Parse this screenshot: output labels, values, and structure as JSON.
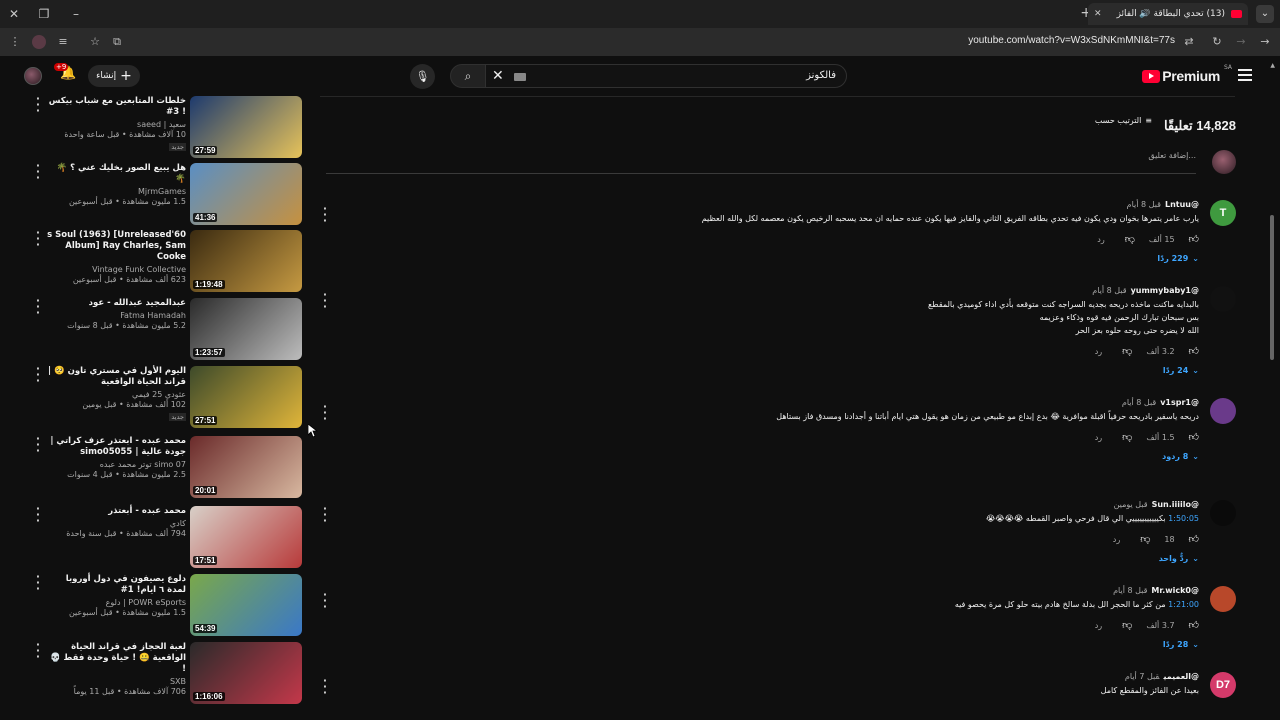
{
  "browser": {
    "tab_title": "(13) تحدي البطاقة 🔊 الفائز",
    "url": "youtube.com/watch?v=W3xSdNKmMNI&t=77s"
  },
  "header": {
    "logo_text": "Premium",
    "logo_sup": "SA",
    "search_query": "فالكونز",
    "create_label": "إنشاء",
    "notif_badge": "+9"
  },
  "recommendations": [
    {
      "title": "خلطات المتابعين مع شباب بيكس ! 3#",
      "channel": "سعيد | saeed",
      "stats": "10 آلاف مشاهدة • قبل ساعة واحدة",
      "badge": "جديد",
      "duration": "27:59",
      "colors": [
        "#1d3a6e",
        "#e7c35a"
      ]
    },
    {
      "title": "هل يبيع الصور بخليك عني ؟ 🌴🌴",
      "channel": "MjrmGames",
      "stats": "1.5 مليون مشاهدة • قبل أسبوعين",
      "badge": "",
      "duration": "41:36",
      "colors": [
        "#5a8fc4",
        "#c6913f"
      ]
    },
    {
      "title": "60's Soul (1963) [Unreleased Album] Ray Charles, Sam Cooke",
      "channel": "Vintage Funk Collective",
      "stats": "623 ألف مشاهدة • قبل أسبوعين",
      "badge": "",
      "duration": "1:19:48",
      "colors": [
        "#3a2a10",
        "#c69a42"
      ]
    },
    {
      "title": "عبدالمجيد عبدالله - عود",
      "channel": "Fatma Hamadah",
      "stats": "5.2 مليون مشاهدة • قبل 8 سنوات",
      "badge": "",
      "duration": "1:23:57",
      "colors": [
        "#2a2a2a",
        "#bdbdbd"
      ]
    },
    {
      "title": "اليوم الأول في مستري تاون 🥺 | قراند الحياة الواقعية",
      "channel": "عثودي 25 فيمي",
      "stats": "102 ألف مشاهدة • قبل يومين",
      "badge": "جديد",
      "duration": "27:51",
      "colors": [
        "#3d4a2a",
        "#e0b53a"
      ]
    },
    {
      "title": "محمد عبده - ابعتذر عزف كراتي | جودة عالية | simo05055",
      "channel": "simo 07 توتر محمد عبده",
      "stats": "2.5 مليون مشاهدة • قبل 4 سنوات",
      "badge": "",
      "duration": "20:01",
      "colors": [
        "#6a2a2a",
        "#d8b8a0"
      ]
    },
    {
      "title": "محمد عبده - أبعتذر",
      "channel": "كادي",
      "stats": "794 ألف مشاهدة • قبل سنة واحدة",
      "badge": "",
      "duration": "17:51",
      "colors": [
        "#d8d0c8",
        "#b83a3a"
      ]
    },
    {
      "title": "دلوع يصيفون في دول أوروبا لمدة ٦ ايام! 1#",
      "channel": "POWR eSports | دلوع",
      "stats": "1.5 مليون مشاهدة • قبل أسبوعين",
      "badge": "",
      "duration": "54:39",
      "colors": [
        "#7aa84a",
        "#3a78c8"
      ]
    },
    {
      "title": "لعبة الحجاز في قراند الحياة الواقعية 🤐 ! حياة وحدة فقط 💀 !",
      "channel": "SXB",
      "stats": "706 آلاف مشاهدة • قبل 11 يوماً",
      "badge": "",
      "duration": "1:16:06",
      "colors": [
        "#2a2a2a",
        "#c4384a"
      ]
    }
  ],
  "comments_header": {
    "count": "14,828 تعليقًا",
    "sort_label": "الترتيب حسب",
    "add_placeholder": "إضافة تعليق..."
  },
  "comments": [
    {
      "author": "@Lntuu",
      "time": "قبل 8 أيام",
      "avatar_letter": "T",
      "avatar_color": "#3f9a3f",
      "timestamp": "",
      "text": "يارب عامر يتمرها بخوان ودي يكون فيه تحدي بطاقه الفريق الثاني والفايز فيها يكون عنده حمايه ان محد يسحبه الرخيص يكون معصمه لكل والله العظيم",
      "likes": "15 ألف",
      "reply_label": "رد",
      "replies": "229 ردًا"
    },
    {
      "author": "@yummybaby1",
      "time": "قبل 8 أيام",
      "avatar_letter": "",
      "avatar_color": "#111111",
      "timestamp": "",
      "text": "بالبدايه ماكنت ماخذه دريحه بجديه السراجه كنت متوقعه بأدي اداء كوميدي بالمقطع\nبس سبحان تبارك الرحمن فيه قوه وذكاء وعزيمه\nالله لا يضره حتى روحه حلوه بعز الحر",
      "likes": "3.2 ألف",
      "reply_label": "رد",
      "replies": "24 ردًا"
    },
    {
      "author": "@v1spr1",
      "time": "قبل 8 أيام",
      "avatar_letter": "",
      "avatar_color": "#6a3a8a",
      "timestamp": "",
      "text": "دريحه ياسفير بادريحه حرفياً اقبلة موافرية 😂 بدع إبداع مو طبيعي من زمان هو يقول هتي ايام أباتنا و أجدادنا ومسدق فاز بستاهل",
      "likes": "1.5 ألف",
      "reply_label": "رد",
      "replies": "8 ردود"
    },
    {
      "author": "@Sun.iiiilo",
      "time": "قبل يومين",
      "avatar_letter": "",
      "avatar_color": "#0a0a0a",
      "timestamp": "1:50:05",
      "text": "بكيييييييييييي الي قال فرحي واصبر القمطه 😭😭😭😭",
      "likes": "18",
      "reply_label": "رد",
      "replies": "ردٌّ واحد"
    },
    {
      "author": "@Mr.wick0",
      "time": "قبل 8 أيام",
      "avatar_letter": "",
      "avatar_color": "#b8482a",
      "timestamp": "1:21:00",
      "text": "من كثر ما الحجر الل بدلة سالخ هادم بيته حلو كل مرة يحصو فيه",
      "likes": "3.7 ألف",
      "reply_label": "رد",
      "replies": "28 ردًا"
    },
    {
      "author": "@العميمي",
      "time": "قبل 7 أيام",
      "avatar_letter": "D7",
      "avatar_color": "#d43a6a",
      "timestamp": "",
      "text": "بعيدا عن الفائز والمقطع كامل",
      "likes": "",
      "reply_label": "",
      "replies": ""
    }
  ]
}
